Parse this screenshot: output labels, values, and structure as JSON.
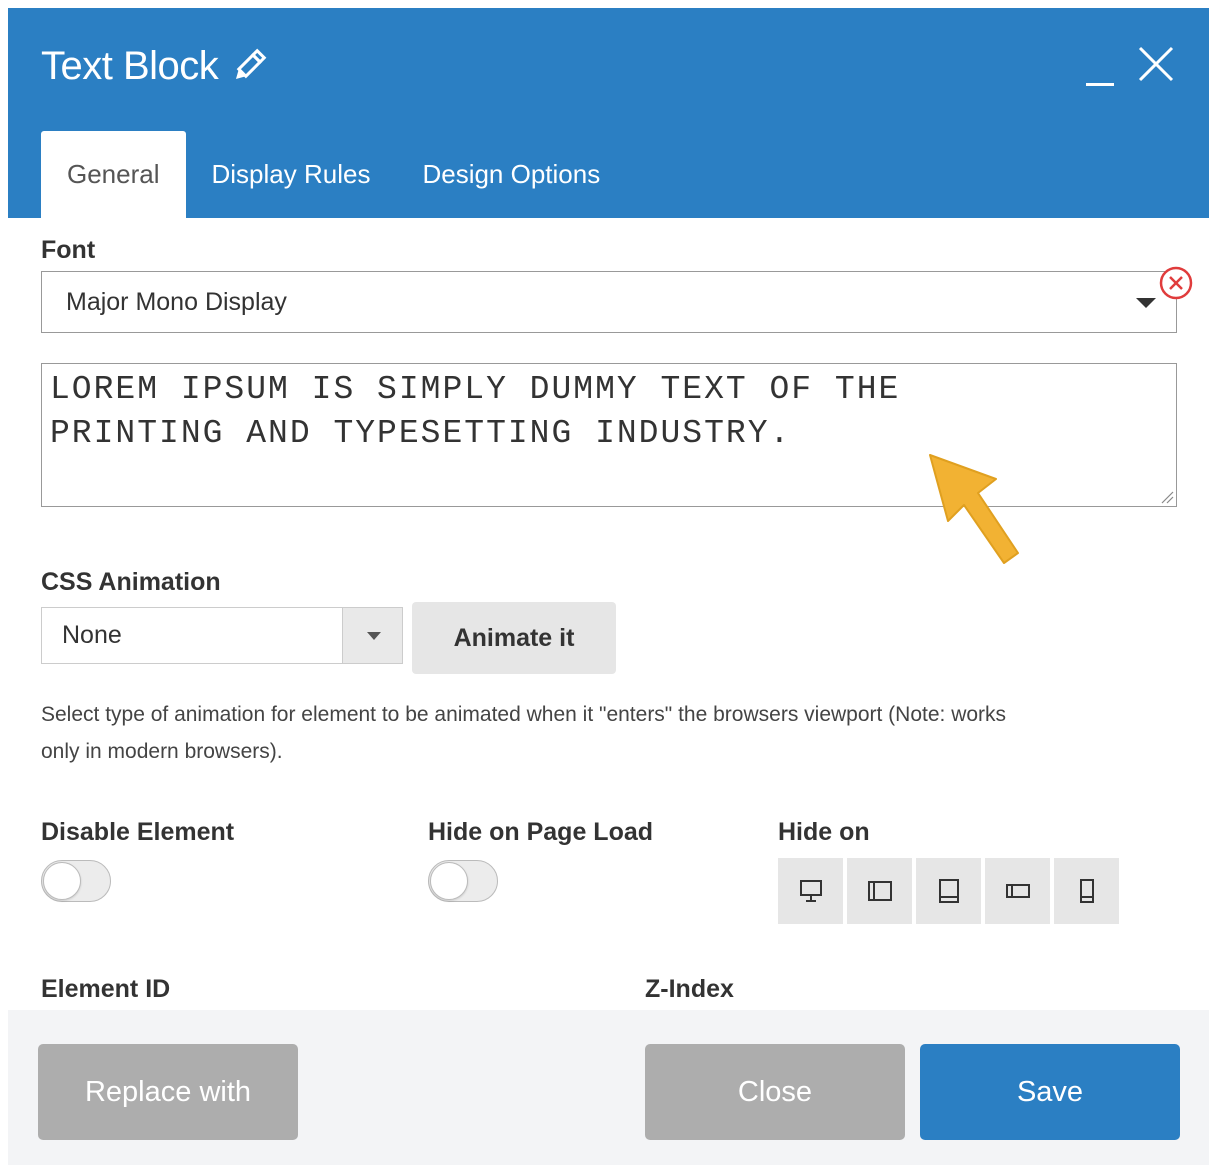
{
  "header": {
    "title": "Text Block",
    "title_icon": "pencil-icon",
    "minimize_icon": "minimize-icon",
    "close_icon": "close-icon",
    "background_color": "#2b7fc3"
  },
  "tabs": [
    {
      "label": "General",
      "active": true
    },
    {
      "label": "Display Rules",
      "active": false
    },
    {
      "label": "Design Options",
      "active": false
    }
  ],
  "font": {
    "label": "Font",
    "value": "Major Mono Display",
    "remove_icon": "remove-circle-icon"
  },
  "text_content": {
    "line1": "LOREM IPSUM IS SIMPLY DUMMY TEXT OF THE",
    "line2": "PRINTING AND TYPESETTING INDUSTRY."
  },
  "annotation": {
    "icon": "arrow-pointer-icon",
    "color": "#f2b233"
  },
  "css_animation": {
    "label": "CSS Animation",
    "value": "None",
    "animate_button": "Animate it",
    "help_line1": "Select type of animation for element to be animated when it \"enters\" the browsers viewport (Note: works",
    "help_line2": "only in modern browsers)."
  },
  "toggles": {
    "disable_element": {
      "label": "Disable Element",
      "on": false
    },
    "hide_on_page_load": {
      "label": "Hide on Page Load",
      "on": false
    }
  },
  "hide_on": {
    "label": "Hide on",
    "devices": [
      "desktop-icon",
      "tablet-landscape-icon",
      "tablet-portrait-icon",
      "mobile-landscape-icon",
      "mobile-portrait-icon"
    ]
  },
  "element_id": {
    "label": "Element ID"
  },
  "z_index": {
    "label": "Z-Index"
  },
  "footer": {
    "replace_label": "Replace with",
    "close_label": "Close",
    "save_label": "Save"
  }
}
